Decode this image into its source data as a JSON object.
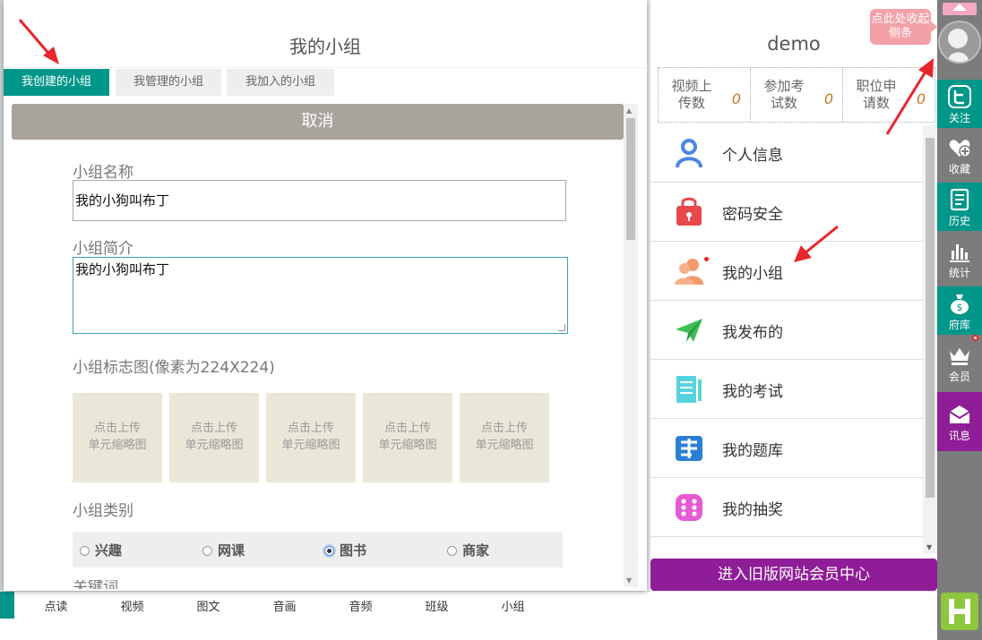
{
  "group_panel": {
    "title": "我的小组",
    "tabs": [
      {
        "label": "我创建的小组",
        "active": true
      },
      {
        "label": "我管理的小组",
        "active": false
      },
      {
        "label": "我加入的小组",
        "active": false
      }
    ],
    "cancel_label": "取消",
    "name_label": "小组名称",
    "name_value": "我的小狗叫布丁",
    "intro_label": "小组简介",
    "intro_value": "我的小狗叫布丁",
    "logo_label": "小组标志图(像素为224X224)",
    "upload_text_1": "点击上传",
    "upload_text_2": "单元缩略图",
    "category_label": "小组类别",
    "categories": [
      {
        "label": "兴趣",
        "checked": false
      },
      {
        "label": "网课",
        "checked": false
      },
      {
        "label": "图书",
        "checked": true
      },
      {
        "label": "商家",
        "checked": false
      }
    ],
    "next_label": "关键词"
  },
  "bottom_nav": [
    "点读",
    "视频",
    "图文",
    "音画",
    "音频",
    "班级",
    "小组"
  ],
  "member_panel": {
    "username": "demo",
    "stats": [
      {
        "label": "视频上传数",
        "value": "0"
      },
      {
        "label": "参加考试数",
        "value": "0"
      },
      {
        "label": "职位申请数",
        "value": "0"
      }
    ],
    "menu": [
      {
        "label": "个人信息",
        "icon": "user-icon"
      },
      {
        "label": "密码安全",
        "icon": "lock-icon"
      },
      {
        "label": "我的小组",
        "icon": "group-icon"
      },
      {
        "label": "我发布的",
        "icon": "paper-plane-icon"
      },
      {
        "label": "我的考试",
        "icon": "exam-icon"
      },
      {
        "label": "我的题库",
        "icon": "question-bank-icon"
      },
      {
        "label": "我的抽奖",
        "icon": "dice-icon"
      }
    ],
    "old_center_label": "进入旧版网站会员中心"
  },
  "sidebar": {
    "tooltip": "点此处收起侧条",
    "items": [
      {
        "label": "关注",
        "icon": "twitter-bird-icon"
      },
      {
        "label": "收藏",
        "icon": "heart-plus-icon"
      },
      {
        "label": "历史",
        "icon": "document-icon"
      },
      {
        "label": "统计",
        "icon": "bar-chart-icon"
      },
      {
        "label": "府库",
        "icon": "money-bag-icon"
      },
      {
        "label": "会员",
        "icon": "crown-icon"
      },
      {
        "label": "讯息",
        "icon": "envelope-icon"
      }
    ]
  },
  "colors": {
    "teal": "#00968a",
    "purple": "#8e1d97",
    "cancel_gray": "#a8a39d",
    "sidebar_gray": "#7c7c7c"
  }
}
